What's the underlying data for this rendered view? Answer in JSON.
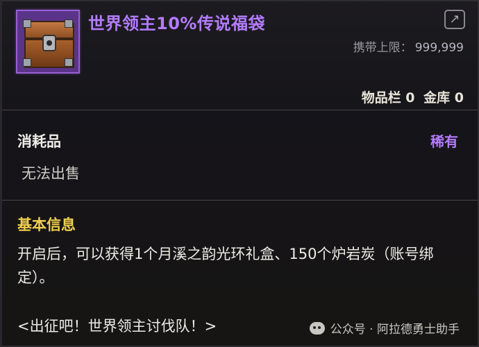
{
  "item": {
    "title": "世界领主10%传说福袋",
    "icon": "treasure-chest-icon",
    "limit_label": "携带上限：",
    "limit_value": "999,999",
    "storage_inventory": "物品栏 0",
    "storage_bank": "金库 0",
    "type": "消耗品",
    "rarity": "稀有",
    "sell_status": "无法出售",
    "info_title": "基本信息",
    "description": "开启后，可以获得1个月溪之韵光环礼盒、150个炉岩炭（账号绑定）。",
    "event": "<出征吧！世界领主讨伐队！>"
  },
  "share_icon": "share-icon",
  "watermark": {
    "icon": "wechat-icon",
    "text": "公众号 · 阿拉德勇士助手"
  },
  "colors": {
    "title": "#b47cff",
    "rarity": "#b47cff",
    "info_title": "#f0cf4e",
    "icon_frame": "#9a5fd6"
  }
}
